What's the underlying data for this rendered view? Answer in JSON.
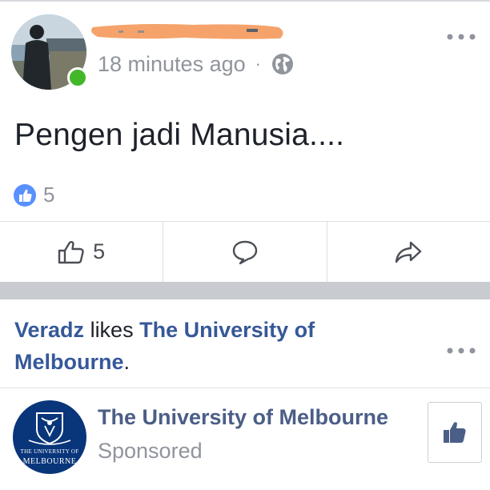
{
  "post": {
    "timestamp": "18 minutes ago",
    "separator": "·",
    "privacy_icon": "globe-icon",
    "status_text": "Pengen jadi Manusia....",
    "reactions": {
      "icon": "like-badge-icon",
      "count": "5"
    },
    "actions": [
      {
        "name": "like",
        "icon": "thumbs-up-outline-icon",
        "count": "5"
      },
      {
        "name": "comment",
        "icon": "comment-bubble-icon"
      },
      {
        "name": "share",
        "icon": "share-arrow-icon"
      }
    ]
  },
  "story": {
    "header": {
      "actor": "Veradz",
      "verb": " likes ",
      "page": "The University of Melbourne",
      "end": "."
    },
    "page_name": "The University of Melbourne",
    "sponsored_label": "Sponsored",
    "logo": {
      "line1": "THE UNIVERSITY OF",
      "line2": "MELBOURNE"
    },
    "like_page_icon": "thumbs-up-filled-icon"
  },
  "colors": {
    "link_blue": "#365899",
    "page_name": "#4b5e87",
    "meta_gray": "#90949c",
    "online_green": "#42b72a",
    "reaction_blue": "#5890ff",
    "logo_navy": "#09357a",
    "feed_gap": "#c8ccd1",
    "redaction_orange": "#f5a36b"
  }
}
